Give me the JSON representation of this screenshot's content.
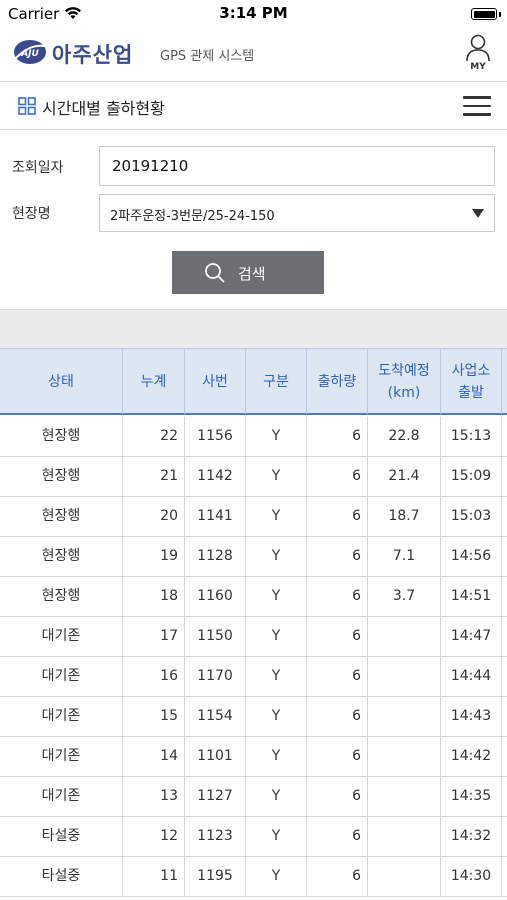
{
  "status_bar": {
    "carrier": "Carrier",
    "time": "3:14 PM"
  },
  "brand": {
    "logo_text": "AJU",
    "name": "아주산업",
    "subtitle": "GPS 관제 시스템",
    "my_label": "MY"
  },
  "page": {
    "title": "시간대별 출하현황"
  },
  "form": {
    "date_label": "조회일자",
    "date_value": "20191210",
    "site_label": "현장명",
    "site_value": "2파주운정-3번문/25-24-150",
    "search_label": "검색"
  },
  "table": {
    "headers": [
      "상태",
      "누계",
      "사번",
      "구분",
      "출하량",
      "도착예정\n(km)",
      "사업소\n출발"
    ],
    "rows": [
      [
        "현장행",
        "22",
        "1156",
        "Y",
        "6",
        "22.8",
        "15:13"
      ],
      [
        "현장행",
        "21",
        "1142",
        "Y",
        "6",
        "21.4",
        "15:09"
      ],
      [
        "현장행",
        "20",
        "1141",
        "Y",
        "6",
        "18.7",
        "15:03"
      ],
      [
        "현장행",
        "19",
        "1128",
        "Y",
        "6",
        "7.1",
        "14:56"
      ],
      [
        "현장행",
        "18",
        "1160",
        "Y",
        "6",
        "3.7",
        "14:51"
      ],
      [
        "대기존",
        "17",
        "1150",
        "Y",
        "6",
        "",
        "14:47"
      ],
      [
        "대기존",
        "16",
        "1170",
        "Y",
        "6",
        "",
        "14:44"
      ],
      [
        "대기존",
        "15",
        "1154",
        "Y",
        "6",
        "",
        "14:43"
      ],
      [
        "대기존",
        "14",
        "1101",
        "Y",
        "6",
        "",
        "14:42"
      ],
      [
        "대기존",
        "13",
        "1127",
        "Y",
        "6",
        "",
        "14:35"
      ],
      [
        "타설중",
        "12",
        "1123",
        "Y",
        "6",
        "",
        "14:32"
      ],
      [
        "타설중",
        "11",
        "1195",
        "Y",
        "6",
        "",
        "14:30"
      ]
    ]
  },
  "colors": {
    "brand": "#3b4a8c",
    "header_bg": "#dde7f4",
    "header_text": "#2f5fb3",
    "button_bg": "#6b6e73"
  }
}
